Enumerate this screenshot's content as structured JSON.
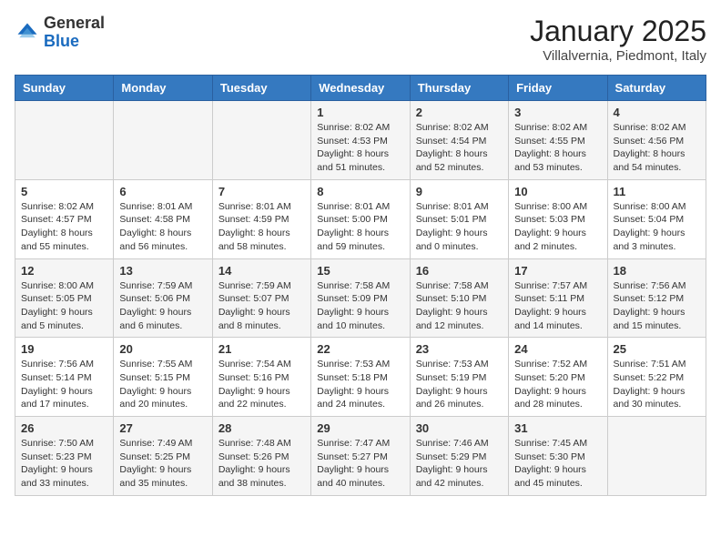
{
  "logo": {
    "general": "General",
    "blue": "Blue"
  },
  "header": {
    "month": "January 2025",
    "location": "Villalvernia, Piedmont, Italy"
  },
  "days": [
    "Sunday",
    "Monday",
    "Tuesday",
    "Wednesday",
    "Thursday",
    "Friday",
    "Saturday"
  ],
  "weeks": [
    [
      {
        "day": "",
        "content": ""
      },
      {
        "day": "",
        "content": ""
      },
      {
        "day": "",
        "content": ""
      },
      {
        "day": "1",
        "content": "Sunrise: 8:02 AM\nSunset: 4:53 PM\nDaylight: 8 hours\nand 51 minutes."
      },
      {
        "day": "2",
        "content": "Sunrise: 8:02 AM\nSunset: 4:54 PM\nDaylight: 8 hours\nand 52 minutes."
      },
      {
        "day": "3",
        "content": "Sunrise: 8:02 AM\nSunset: 4:55 PM\nDaylight: 8 hours\nand 53 minutes."
      },
      {
        "day": "4",
        "content": "Sunrise: 8:02 AM\nSunset: 4:56 PM\nDaylight: 8 hours\nand 54 minutes."
      }
    ],
    [
      {
        "day": "5",
        "content": "Sunrise: 8:02 AM\nSunset: 4:57 PM\nDaylight: 8 hours\nand 55 minutes."
      },
      {
        "day": "6",
        "content": "Sunrise: 8:01 AM\nSunset: 4:58 PM\nDaylight: 8 hours\nand 56 minutes."
      },
      {
        "day": "7",
        "content": "Sunrise: 8:01 AM\nSunset: 4:59 PM\nDaylight: 8 hours\nand 58 minutes."
      },
      {
        "day": "8",
        "content": "Sunrise: 8:01 AM\nSunset: 5:00 PM\nDaylight: 8 hours\nand 59 minutes."
      },
      {
        "day": "9",
        "content": "Sunrise: 8:01 AM\nSunset: 5:01 PM\nDaylight: 9 hours\nand 0 minutes."
      },
      {
        "day": "10",
        "content": "Sunrise: 8:00 AM\nSunset: 5:03 PM\nDaylight: 9 hours\nand 2 minutes."
      },
      {
        "day": "11",
        "content": "Sunrise: 8:00 AM\nSunset: 5:04 PM\nDaylight: 9 hours\nand 3 minutes."
      }
    ],
    [
      {
        "day": "12",
        "content": "Sunrise: 8:00 AM\nSunset: 5:05 PM\nDaylight: 9 hours\nand 5 minutes."
      },
      {
        "day": "13",
        "content": "Sunrise: 7:59 AM\nSunset: 5:06 PM\nDaylight: 9 hours\nand 6 minutes."
      },
      {
        "day": "14",
        "content": "Sunrise: 7:59 AM\nSunset: 5:07 PM\nDaylight: 9 hours\nand 8 minutes."
      },
      {
        "day": "15",
        "content": "Sunrise: 7:58 AM\nSunset: 5:09 PM\nDaylight: 9 hours\nand 10 minutes."
      },
      {
        "day": "16",
        "content": "Sunrise: 7:58 AM\nSunset: 5:10 PM\nDaylight: 9 hours\nand 12 minutes."
      },
      {
        "day": "17",
        "content": "Sunrise: 7:57 AM\nSunset: 5:11 PM\nDaylight: 9 hours\nand 14 minutes."
      },
      {
        "day": "18",
        "content": "Sunrise: 7:56 AM\nSunset: 5:12 PM\nDaylight: 9 hours\nand 15 minutes."
      }
    ],
    [
      {
        "day": "19",
        "content": "Sunrise: 7:56 AM\nSunset: 5:14 PM\nDaylight: 9 hours\nand 17 minutes."
      },
      {
        "day": "20",
        "content": "Sunrise: 7:55 AM\nSunset: 5:15 PM\nDaylight: 9 hours\nand 20 minutes."
      },
      {
        "day": "21",
        "content": "Sunrise: 7:54 AM\nSunset: 5:16 PM\nDaylight: 9 hours\nand 22 minutes."
      },
      {
        "day": "22",
        "content": "Sunrise: 7:53 AM\nSunset: 5:18 PM\nDaylight: 9 hours\nand 24 minutes."
      },
      {
        "day": "23",
        "content": "Sunrise: 7:53 AM\nSunset: 5:19 PM\nDaylight: 9 hours\nand 26 minutes."
      },
      {
        "day": "24",
        "content": "Sunrise: 7:52 AM\nSunset: 5:20 PM\nDaylight: 9 hours\nand 28 minutes."
      },
      {
        "day": "25",
        "content": "Sunrise: 7:51 AM\nSunset: 5:22 PM\nDaylight: 9 hours\nand 30 minutes."
      }
    ],
    [
      {
        "day": "26",
        "content": "Sunrise: 7:50 AM\nSunset: 5:23 PM\nDaylight: 9 hours\nand 33 minutes."
      },
      {
        "day": "27",
        "content": "Sunrise: 7:49 AM\nSunset: 5:25 PM\nDaylight: 9 hours\nand 35 minutes."
      },
      {
        "day": "28",
        "content": "Sunrise: 7:48 AM\nSunset: 5:26 PM\nDaylight: 9 hours\nand 38 minutes."
      },
      {
        "day": "29",
        "content": "Sunrise: 7:47 AM\nSunset: 5:27 PM\nDaylight: 9 hours\nand 40 minutes."
      },
      {
        "day": "30",
        "content": "Sunrise: 7:46 AM\nSunset: 5:29 PM\nDaylight: 9 hours\nand 42 minutes."
      },
      {
        "day": "31",
        "content": "Sunrise: 7:45 AM\nSunset: 5:30 PM\nDaylight: 9 hours\nand 45 minutes."
      },
      {
        "day": "",
        "content": ""
      }
    ]
  ]
}
